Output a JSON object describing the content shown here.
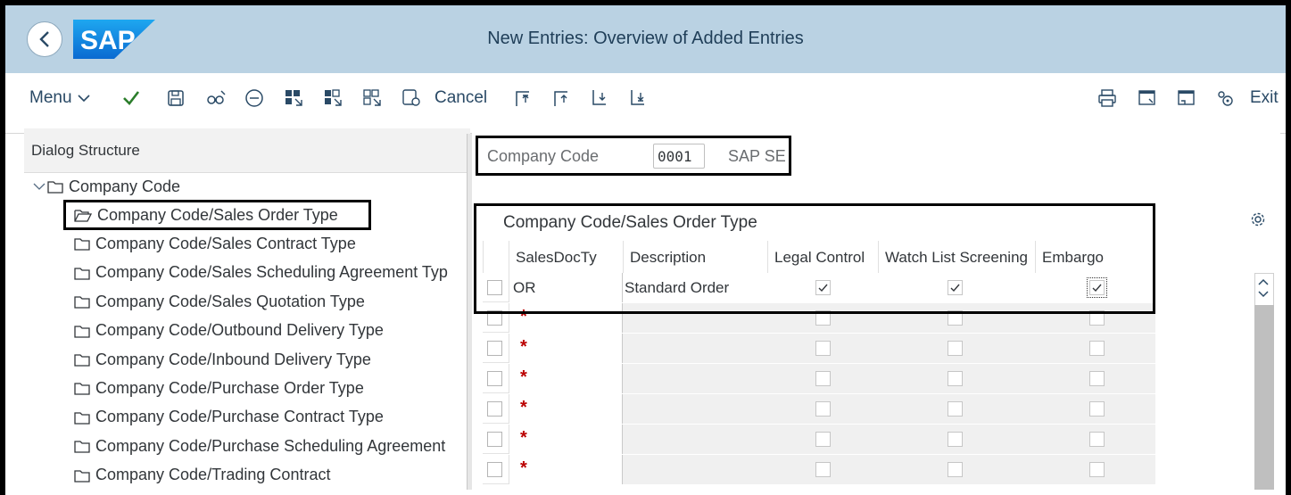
{
  "window": {
    "title": "New Entries: Overview of Added Entries",
    "logo": "SAP"
  },
  "colors": {
    "title_bar": "#bad2e3",
    "accent": "#2a4a66",
    "required": "#bb0000",
    "check_green": "#2b7d2b"
  },
  "toolbar": {
    "menu_label": "Menu",
    "cancel_label": "Cancel",
    "exit_label": "Exit",
    "icons": [
      "checkmark-icon",
      "save-icon",
      "find-icon",
      "minus-circle-icon",
      "select-all-icon",
      "select-block-icon",
      "deselect-all-icon",
      "configure-icon",
      "first-page-icon",
      "previous-page-icon",
      "next-page-icon",
      "last-page-icon",
      "print-icon",
      "new-window-icon",
      "window-minimize-icon",
      "help-icon"
    ]
  },
  "dialog": {
    "header": "Dialog Structure",
    "root": "Company Code",
    "items": [
      "Company Code/Sales Order Type",
      "Company Code/Sales Contract Type",
      "Company Code/Sales Scheduling Agreement Typ",
      "Company Code/Sales Quotation Type",
      "Company Code/Outbound Delivery Type",
      "Company Code/Inbound Delivery Type",
      "Company Code/Purchase Order Type",
      "Company Code/Purchase Contract Type",
      "Company Code/Purchase Scheduling Agreement",
      "Company Code/Trading Contract"
    ],
    "selected_index": 0
  },
  "company": {
    "label": "Company Code",
    "value": "0001",
    "name": "SAP SE"
  },
  "table": {
    "title": "Company Code/Sales Order Type",
    "columns": [
      "SalesDocTy",
      "Description",
      "Legal Control",
      "Watch List Screening",
      "Embargo"
    ],
    "rows": [
      {
        "key": "OR",
        "description": "Standard Order",
        "legal": true,
        "watch": true,
        "embargo": true
      },
      {
        "key": "*",
        "description": "",
        "legal": false,
        "watch": false,
        "embargo": false
      },
      {
        "key": "*",
        "description": "",
        "legal": false,
        "watch": false,
        "embargo": false
      },
      {
        "key": "*",
        "description": "",
        "legal": false,
        "watch": false,
        "embargo": false
      },
      {
        "key": "*",
        "description": "",
        "legal": false,
        "watch": false,
        "embargo": false
      },
      {
        "key": "*",
        "description": "",
        "legal": false,
        "watch": false,
        "embargo": false
      },
      {
        "key": "*",
        "description": "",
        "legal": false,
        "watch": false,
        "embargo": false
      }
    ]
  }
}
